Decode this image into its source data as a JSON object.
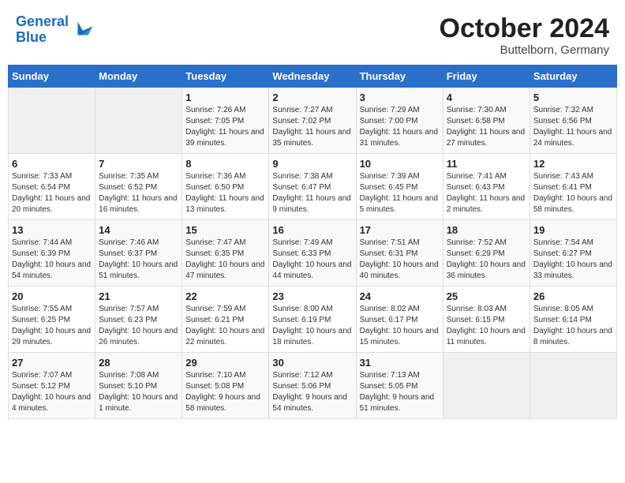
{
  "header": {
    "logo_general": "General",
    "logo_blue": "Blue",
    "month": "October 2024",
    "location": "Buttelborn, Germany"
  },
  "weekdays": [
    "Sunday",
    "Monday",
    "Tuesday",
    "Wednesday",
    "Thursday",
    "Friday",
    "Saturday"
  ],
  "weeks": [
    [
      {
        "day": "",
        "sunrise": "",
        "sunset": "",
        "daylight": ""
      },
      {
        "day": "",
        "sunrise": "",
        "sunset": "",
        "daylight": ""
      },
      {
        "day": "1",
        "sunrise": "Sunrise: 7:26 AM",
        "sunset": "Sunset: 7:05 PM",
        "daylight": "Daylight: 11 hours and 39 minutes."
      },
      {
        "day": "2",
        "sunrise": "Sunrise: 7:27 AM",
        "sunset": "Sunset: 7:02 PM",
        "daylight": "Daylight: 11 hours and 35 minutes."
      },
      {
        "day": "3",
        "sunrise": "Sunrise: 7:29 AM",
        "sunset": "Sunset: 7:00 PM",
        "daylight": "Daylight: 11 hours and 31 minutes."
      },
      {
        "day": "4",
        "sunrise": "Sunrise: 7:30 AM",
        "sunset": "Sunset: 6:58 PM",
        "daylight": "Daylight: 11 hours and 27 minutes."
      },
      {
        "day": "5",
        "sunrise": "Sunrise: 7:32 AM",
        "sunset": "Sunset: 6:56 PM",
        "daylight": "Daylight: 11 hours and 24 minutes."
      }
    ],
    [
      {
        "day": "6",
        "sunrise": "Sunrise: 7:33 AM",
        "sunset": "Sunset: 6:54 PM",
        "daylight": "Daylight: 11 hours and 20 minutes."
      },
      {
        "day": "7",
        "sunrise": "Sunrise: 7:35 AM",
        "sunset": "Sunset: 6:52 PM",
        "daylight": "Daylight: 11 hours and 16 minutes."
      },
      {
        "day": "8",
        "sunrise": "Sunrise: 7:36 AM",
        "sunset": "Sunset: 6:50 PM",
        "daylight": "Daylight: 11 hours and 13 minutes."
      },
      {
        "day": "9",
        "sunrise": "Sunrise: 7:38 AM",
        "sunset": "Sunset: 6:47 PM",
        "daylight": "Daylight: 11 hours and 9 minutes."
      },
      {
        "day": "10",
        "sunrise": "Sunrise: 7:39 AM",
        "sunset": "Sunset: 6:45 PM",
        "daylight": "Daylight: 11 hours and 5 minutes."
      },
      {
        "day": "11",
        "sunrise": "Sunrise: 7:41 AM",
        "sunset": "Sunset: 6:43 PM",
        "daylight": "Daylight: 11 hours and 2 minutes."
      },
      {
        "day": "12",
        "sunrise": "Sunrise: 7:43 AM",
        "sunset": "Sunset: 6:41 PM",
        "daylight": "Daylight: 10 hours and 58 minutes."
      }
    ],
    [
      {
        "day": "13",
        "sunrise": "Sunrise: 7:44 AM",
        "sunset": "Sunset: 6:39 PM",
        "daylight": "Daylight: 10 hours and 54 minutes."
      },
      {
        "day": "14",
        "sunrise": "Sunrise: 7:46 AM",
        "sunset": "Sunset: 6:37 PM",
        "daylight": "Daylight: 10 hours and 51 minutes."
      },
      {
        "day": "15",
        "sunrise": "Sunrise: 7:47 AM",
        "sunset": "Sunset: 6:35 PM",
        "daylight": "Daylight: 10 hours and 47 minutes."
      },
      {
        "day": "16",
        "sunrise": "Sunrise: 7:49 AM",
        "sunset": "Sunset: 6:33 PM",
        "daylight": "Daylight: 10 hours and 44 minutes."
      },
      {
        "day": "17",
        "sunrise": "Sunrise: 7:51 AM",
        "sunset": "Sunset: 6:31 PM",
        "daylight": "Daylight: 10 hours and 40 minutes."
      },
      {
        "day": "18",
        "sunrise": "Sunrise: 7:52 AM",
        "sunset": "Sunset: 6:29 PM",
        "daylight": "Daylight: 10 hours and 36 minutes."
      },
      {
        "day": "19",
        "sunrise": "Sunrise: 7:54 AM",
        "sunset": "Sunset: 6:27 PM",
        "daylight": "Daylight: 10 hours and 33 minutes."
      }
    ],
    [
      {
        "day": "20",
        "sunrise": "Sunrise: 7:55 AM",
        "sunset": "Sunset: 6:25 PM",
        "daylight": "Daylight: 10 hours and 29 minutes."
      },
      {
        "day": "21",
        "sunrise": "Sunrise: 7:57 AM",
        "sunset": "Sunset: 6:23 PM",
        "daylight": "Daylight: 10 hours and 26 minutes."
      },
      {
        "day": "22",
        "sunrise": "Sunrise: 7:59 AM",
        "sunset": "Sunset: 6:21 PM",
        "daylight": "Daylight: 10 hours and 22 minutes."
      },
      {
        "day": "23",
        "sunrise": "Sunrise: 8:00 AM",
        "sunset": "Sunset: 6:19 PM",
        "daylight": "Daylight: 10 hours and 18 minutes."
      },
      {
        "day": "24",
        "sunrise": "Sunrise: 8:02 AM",
        "sunset": "Sunset: 6:17 PM",
        "daylight": "Daylight: 10 hours and 15 minutes."
      },
      {
        "day": "25",
        "sunrise": "Sunrise: 8:03 AM",
        "sunset": "Sunset: 6:15 PM",
        "daylight": "Daylight: 10 hours and 11 minutes."
      },
      {
        "day": "26",
        "sunrise": "Sunrise: 8:05 AM",
        "sunset": "Sunset: 6:14 PM",
        "daylight": "Daylight: 10 hours and 8 minutes."
      }
    ],
    [
      {
        "day": "27",
        "sunrise": "Sunrise: 7:07 AM",
        "sunset": "Sunset: 5:12 PM",
        "daylight": "Daylight: 10 hours and 4 minutes."
      },
      {
        "day": "28",
        "sunrise": "Sunrise: 7:08 AM",
        "sunset": "Sunset: 5:10 PM",
        "daylight": "Daylight: 10 hours and 1 minute."
      },
      {
        "day": "29",
        "sunrise": "Sunrise: 7:10 AM",
        "sunset": "Sunset: 5:08 PM",
        "daylight": "Daylight: 9 hours and 58 minutes."
      },
      {
        "day": "30",
        "sunrise": "Sunrise: 7:12 AM",
        "sunset": "Sunset: 5:06 PM",
        "daylight": "Daylight: 9 hours and 54 minutes."
      },
      {
        "day": "31",
        "sunrise": "Sunrise: 7:13 AM",
        "sunset": "Sunset: 5:05 PM",
        "daylight": "Daylight: 9 hours and 51 minutes."
      },
      {
        "day": "",
        "sunrise": "",
        "sunset": "",
        "daylight": ""
      },
      {
        "day": "",
        "sunrise": "",
        "sunset": "",
        "daylight": ""
      }
    ]
  ]
}
